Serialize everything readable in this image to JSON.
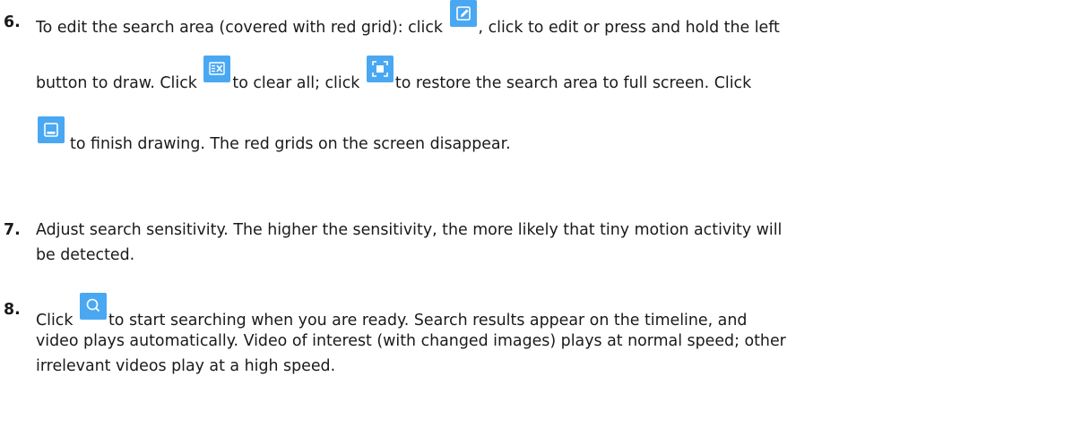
{
  "steps": [
    {
      "number": "6.",
      "lines": [
        {
          "a": "To edit the search area (covered with red grid): click",
          "b": ", click to edit or press and hold the left"
        },
        {
          "a": "button to draw. Click",
          "b": "to clear all; click",
          "c": "to restore the search area to full screen. Click"
        },
        {
          "a": "to finish drawing. The red grids on the screen disappear."
        }
      ],
      "icons": [
        "edit-icon",
        "clear-all-icon",
        "full-screen-icon",
        "finish-drawing-icon"
      ]
    },
    {
      "number": "7.",
      "lines": [
        {
          "a": "Adjust search sensitivity. The higher the sensitivity, the more likely that tiny motion activity will"
        },
        {
          "a": "be detected."
        }
      ]
    },
    {
      "number": "8.",
      "lines": [
        {
          "a": "Click",
          "b": "to start searching when you are ready. Search results appear on the timeline, and"
        },
        {
          "a": "video plays automatically. Video of interest (with changed images) plays at normal speed; other"
        },
        {
          "a": "irrelevant videos play at a high speed."
        }
      ],
      "icons": [
        "search-icon"
      ]
    }
  ],
  "colors": {
    "icon_background": "#4aa8f3",
    "icon_glyph": "#ffffff",
    "text": "#1a1a1a"
  }
}
